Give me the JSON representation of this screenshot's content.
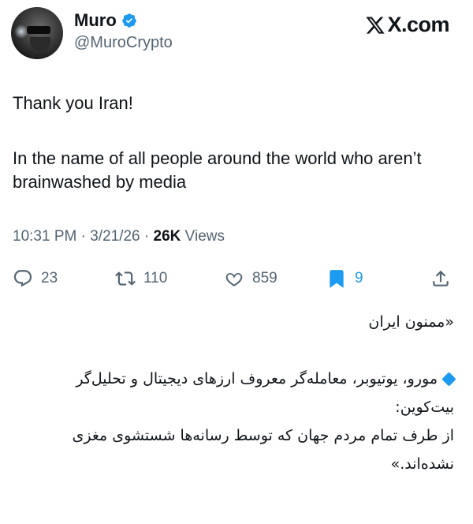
{
  "tweet": {
    "author_name": "Muro",
    "author_handle": "@MuroCrypto",
    "brand": "X.com",
    "line1": "Thank you Iran!",
    "line2": "In the name of all people around the world who aren’t brainwashed by media",
    "time": "10:31 PM",
    "date": "3/21/26",
    "views_count": "26K",
    "views_label": "Views",
    "stats": {
      "replies": "23",
      "reposts": "110",
      "likes": "859",
      "bookmarks": "9"
    }
  },
  "caption": {
    "quote": "«ممنون ایران",
    "body": "مورو، یوتیوبر، معامله‌گر معروف ارزهای دیجیتال و تحلیل‌گر بیت‌کوین:\nاز طرف تمام مردم جهان که توسط رسانه‌ها شستشوی مغزی نشده‌اند.»"
  },
  "colors": {
    "accent": "#1d9bf0",
    "text": "#0f1419",
    "muted": "#536471"
  }
}
